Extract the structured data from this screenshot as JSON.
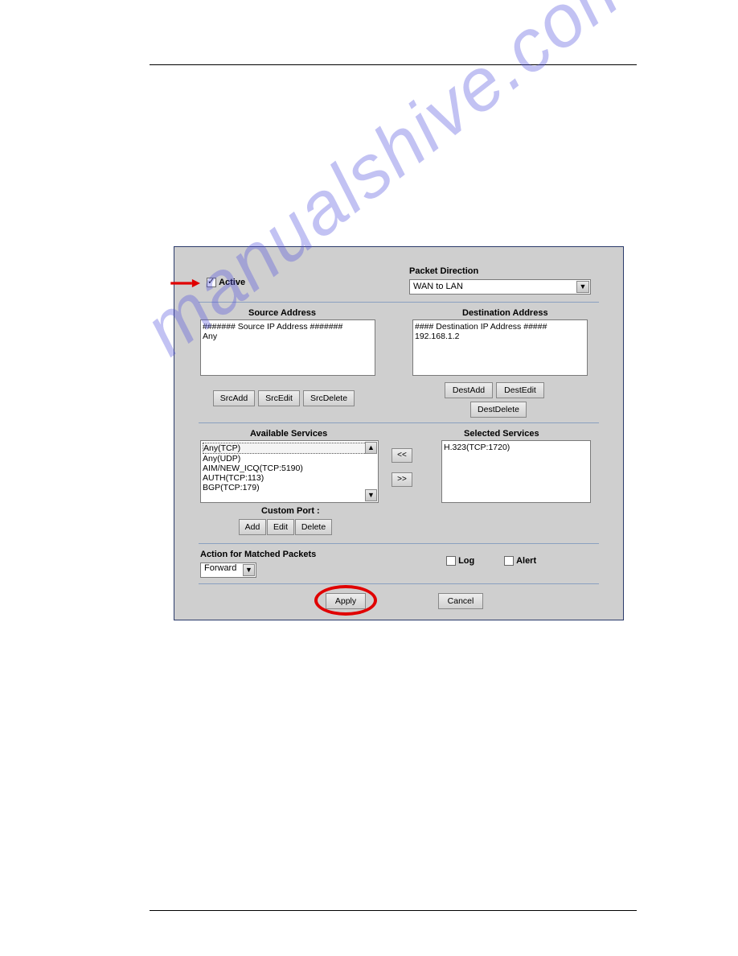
{
  "watermark": "manualshive.com",
  "panel": {
    "active": {
      "label": "Active",
      "checked": true
    },
    "packet_direction": {
      "label": "Packet Direction",
      "value": "WAN to LAN"
    },
    "source": {
      "title": "Source Address",
      "items": [
        "####### Source IP Address #######",
        "Any"
      ],
      "buttons": {
        "add": "SrcAdd",
        "edit": "SrcEdit",
        "del": "SrcDelete"
      }
    },
    "destination": {
      "title": "Destination Address",
      "items": [
        "#### Destination IP Address #####",
        "192.168.1.2"
      ],
      "buttons": {
        "add": "DestAdd",
        "edit": "DestEdit",
        "del": "DestDelete"
      }
    },
    "services": {
      "available_title": "Available Services",
      "selected_title": "Selected Services",
      "available": [
        "Any(TCP)",
        "Any(UDP)",
        "AIM/NEW_ICQ(TCP:5190)",
        "AUTH(TCP:113)",
        "BGP(TCP:179)"
      ],
      "selected": [
        "H.323(TCP:1720)"
      ],
      "move_left": "<<",
      "move_right": ">>",
      "custom_port": {
        "label": "Custom Port :",
        "add": "Add",
        "edit": "Edit",
        "del": "Delete"
      }
    },
    "action": {
      "label": "Action for Matched Packets",
      "value": "Forward",
      "log": "Log",
      "alert": "Alert"
    },
    "buttons": {
      "apply": "Apply",
      "cancel": "Cancel"
    }
  }
}
